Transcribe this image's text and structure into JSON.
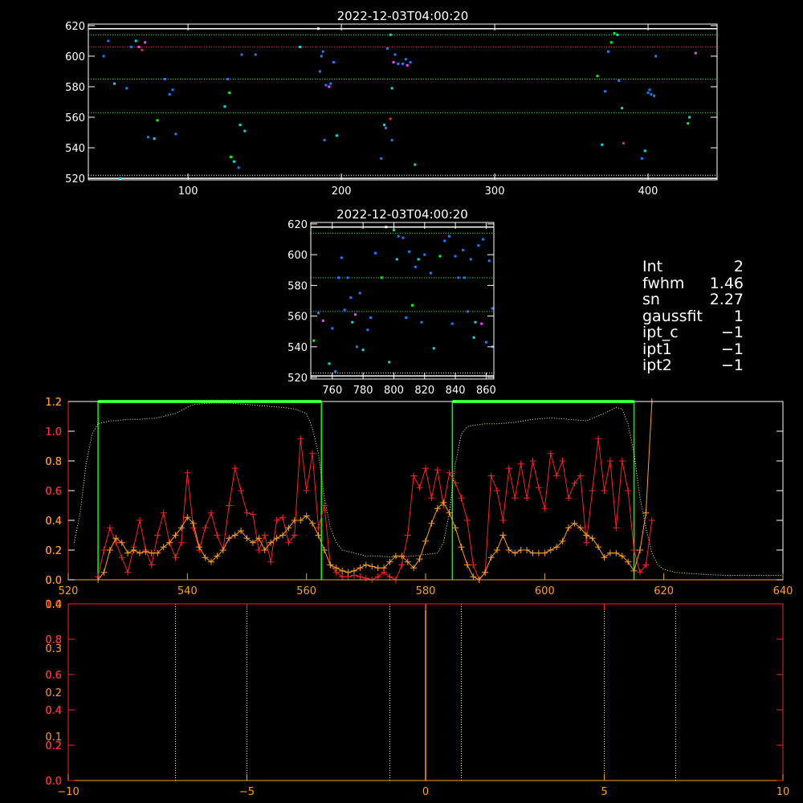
{
  "colors": {
    "background": "#000000",
    "white": "#ffffff",
    "green": "#00ff00",
    "red": "#ff2020",
    "orange": "#ff9f1a",
    "yellow": "#ffff80",
    "blue": "#1e7bff",
    "cyan": "#00e0e0",
    "magenta": "#ff40ff"
  },
  "info": [
    {
      "key": "Int",
      "value": "2"
    },
    {
      "key": "fwhm",
      "value": "1.46"
    },
    {
      "key": "sn",
      "value": "2.27"
    },
    {
      "key": "gaussfit",
      "value": "1"
    },
    {
      "key": "ipt_c",
      "value": "−1"
    },
    {
      "key": "ipt1",
      "value": "−1"
    },
    {
      "key": "ipt2",
      "value": "−1"
    }
  ],
  "chart_data": [
    {
      "type": "scatter",
      "title": "2022-12-03T04:00:20",
      "xlim": [
        35,
        445
      ],
      "ylim": [
        519,
        621
      ],
      "xticks": [
        100,
        200,
        300,
        400
      ],
      "yticks": [
        520,
        540,
        560,
        580,
        600,
        620
      ],
      "hlines": [
        {
          "y": 618,
          "style": "solid",
          "color": "white"
        },
        {
          "y": 614,
          "style": "dotted",
          "color": "green"
        },
        {
          "y": 606,
          "style": "dotted",
          "color": "red"
        },
        {
          "y": 585,
          "style": "dotted",
          "color": "green"
        },
        {
          "y": 563,
          "style": "dotted",
          "color": "green"
        },
        {
          "y": 522,
          "style": "dotted",
          "color": "white"
        },
        {
          "y": 520,
          "style": "solid",
          "color": "white"
        }
      ],
      "points": [
        [
          45,
          600,
          "blue"
        ],
        [
          48,
          610,
          "blue"
        ],
        [
          52,
          582,
          "cyan"
        ],
        [
          56,
          520,
          "cyan"
        ],
        [
          60,
          579,
          "blue"
        ],
        [
          63,
          606,
          "blue"
        ],
        [
          66,
          610,
          "cyan"
        ],
        [
          68,
          606,
          "magenta"
        ],
        [
          70,
          604,
          "red"
        ],
        [
          72,
          609,
          "magenta"
        ],
        [
          74,
          547,
          "blue"
        ],
        [
          78,
          546,
          "cyan"
        ],
        [
          80,
          558,
          "green"
        ],
        [
          85,
          585,
          "blue"
        ],
        [
          88,
          575,
          "blue"
        ],
        [
          90,
          578,
          "blue"
        ],
        [
          92,
          549,
          "blue"
        ],
        [
          124,
          567,
          "cyan"
        ],
        [
          126,
          585,
          "blue"
        ],
        [
          127,
          576,
          "green"
        ],
        [
          128,
          534,
          "green"
        ],
        [
          130,
          531,
          "cyan"
        ],
        [
          133,
          527,
          "blue"
        ],
        [
          134,
          555,
          "cyan"
        ],
        [
          135,
          601,
          "blue"
        ],
        [
          137,
          551,
          "cyan"
        ],
        [
          144,
          601,
          "blue"
        ],
        [
          173,
          606,
          "cyan"
        ],
        [
          185,
          618,
          "white"
        ],
        [
          186,
          590,
          "blue"
        ],
        [
          187,
          600,
          "blue"
        ],
        [
          188,
          603,
          "blue"
        ],
        [
          189,
          545,
          "blue"
        ],
        [
          190,
          581,
          "blue"
        ],
        [
          192,
          580,
          "magenta"
        ],
        [
          193,
          582,
          "blue"
        ],
        [
          195,
          596,
          "blue"
        ],
        [
          197,
          548,
          "cyan"
        ],
        [
          226,
          533,
          "blue"
        ],
        [
          228,
          555,
          "cyan"
        ],
        [
          229,
          553,
          "blue"
        ],
        [
          230,
          605,
          "blue"
        ],
        [
          232,
          559,
          "red"
        ],
        [
          233,
          579,
          "cyan"
        ],
        [
          233,
          545,
          "blue"
        ],
        [
          234,
          596,
          "magenta"
        ],
        [
          235,
          601,
          "blue"
        ],
        [
          237,
          595,
          "blue"
        ],
        [
          240,
          595,
          "blue"
        ],
        [
          242,
          598,
          "blue"
        ],
        [
          243,
          594,
          "magenta"
        ],
        [
          245,
          596,
          "blue"
        ],
        [
          248,
          529,
          "green"
        ],
        [
          232,
          614,
          "cyan"
        ],
        [
          367,
          587,
          "green"
        ],
        [
          370,
          542,
          "cyan"
        ],
        [
          372,
          577,
          "blue"
        ],
        [
          374,
          603,
          "blue"
        ],
        [
          376,
          609,
          "green"
        ],
        [
          378,
          615,
          "green"
        ],
        [
          380,
          614,
          "cyan"
        ],
        [
          381,
          584,
          "blue"
        ],
        [
          383,
          566,
          "cyan"
        ],
        [
          384,
          543,
          "red"
        ],
        [
          396,
          533,
          "blue"
        ],
        [
          398,
          538,
          "cyan"
        ],
        [
          400,
          576,
          "blue"
        ],
        [
          401,
          578,
          "blue"
        ],
        [
          402,
          575,
          "blue"
        ],
        [
          404,
          574,
          "blue"
        ],
        [
          405,
          600,
          "blue"
        ],
        [
          426,
          556,
          "green"
        ],
        [
          427,
          560,
          "cyan"
        ],
        [
          431,
          602,
          "magenta"
        ]
      ]
    },
    {
      "type": "scatter",
      "title": "2022-12-03T04:00:20",
      "xlim": [
        746,
        865
      ],
      "ylim": [
        519,
        621
      ],
      "xticks": [
        760,
        780,
        800,
        820,
        840,
        860
      ],
      "yticks": [
        520,
        540,
        560,
        580,
        600,
        620
      ],
      "hlines": [
        {
          "y": 618,
          "style": "solid",
          "color": "white"
        },
        {
          "y": 614,
          "style": "dotted",
          "color": "green"
        },
        {
          "y": 585,
          "style": "dotted",
          "color": "green"
        },
        {
          "y": 563,
          "style": "dotted",
          "color": "green"
        },
        {
          "y": 523,
          "style": "dotted",
          "color": "white"
        },
        {
          "y": 521,
          "style": "solid",
          "color": "white"
        }
      ],
      "points": [
        [
          748,
          544,
          "green"
        ],
        [
          751,
          562,
          "blue"
        ],
        [
          754,
          557,
          "magenta"
        ],
        [
          758,
          529,
          "cyan"
        ],
        [
          760,
          552,
          "blue"
        ],
        [
          762,
          524,
          "blue"
        ],
        [
          764,
          585,
          "blue"
        ],
        [
          766,
          598,
          "blue"
        ],
        [
          768,
          564,
          "blue"
        ],
        [
          770,
          585,
          "blue"
        ],
        [
          772,
          572,
          "blue"
        ],
        [
          773,
          556,
          "cyan"
        ],
        [
          775,
          561,
          "magenta"
        ],
        [
          776,
          540,
          "blue"
        ],
        [
          778,
          575,
          "blue"
        ],
        [
          780,
          538,
          "cyan"
        ],
        [
          783,
          551,
          "blue"
        ],
        [
          785,
          559,
          "blue"
        ],
        [
          788,
          601,
          "blue"
        ],
        [
          792,
          585,
          "green"
        ],
        [
          795,
          618,
          "white"
        ],
        [
          797,
          530,
          "cyan"
        ],
        [
          800,
          616,
          "green"
        ],
        [
          802,
          597,
          "cyan"
        ],
        [
          803,
          612,
          "blue"
        ],
        [
          806,
          611,
          "blue"
        ],
        [
          808,
          559,
          "blue"
        ],
        [
          810,
          602,
          "blue"
        ],
        [
          812,
          567,
          "green"
        ],
        [
          814,
          592,
          "blue"
        ],
        [
          816,
          597,
          "cyan"
        ],
        [
          818,
          556,
          "blue"
        ],
        [
          820,
          600,
          "blue"
        ],
        [
          824,
          588,
          "blue"
        ],
        [
          826,
          539,
          "cyan"
        ],
        [
          830,
          599,
          "green"
        ],
        [
          833,
          609,
          "blue"
        ],
        [
          836,
          612,
          "blue"
        ],
        [
          838,
          555,
          "blue"
        ],
        [
          840,
          599,
          "blue"
        ],
        [
          842,
          585,
          "blue"
        ],
        [
          845,
          603,
          "blue"
        ],
        [
          846,
          585,
          "blue"
        ],
        [
          848,
          563,
          "blue"
        ],
        [
          850,
          597,
          "blue"
        ],
        [
          852,
          546,
          "cyan"
        ],
        [
          853,
          556,
          "cyan"
        ],
        [
          855,
          606,
          "blue"
        ],
        [
          857,
          555,
          "magenta"
        ],
        [
          858,
          610,
          "blue"
        ],
        [
          860,
          543,
          "blue"
        ],
        [
          862,
          596,
          "blue"
        ],
        [
          864,
          565,
          "blue"
        ],
        [
          864,
          540,
          "blue"
        ]
      ]
    },
    {
      "type": "line",
      "xlim": [
        520,
        640
      ],
      "ylim": [
        0,
        1.2
      ],
      "xticks": [
        520,
        540,
        560,
        580,
        600,
        620,
        640
      ],
      "yticks": [
        0.0,
        0.2,
        0.4,
        0.6,
        0.8,
        1.0,
        1.2
      ],
      "yticks_red": [
        0.0,
        0.2,
        0.4,
        0.6,
        0.8,
        1.0,
        1.2
      ],
      "yticks_orange": [
        0.0,
        0.2,
        0.4,
        0.8,
        1.2
      ],
      "green_boxes": [
        [
          525,
          562.5
        ],
        [
          584.5,
          615
        ]
      ],
      "transmission_x": [
        521,
        522,
        523,
        524,
        525,
        526,
        527,
        528,
        530,
        532,
        535,
        538,
        541,
        544,
        547,
        550,
        553,
        556,
        558,
        560,
        561,
        562,
        563,
        564,
        565,
        566,
        568,
        570,
        572,
        575,
        578,
        580,
        582,
        583,
        584,
        585,
        586,
        587,
        588,
        590,
        592,
        595,
        598,
        601,
        604,
        607,
        610,
        612,
        613,
        614,
        615,
        616,
        617,
        618,
        619,
        620,
        622,
        625,
        630,
        635,
        640
      ],
      "transmission_y": [
        0.25,
        0.45,
        0.78,
        0.98,
        1.05,
        1.06,
        1.07,
        1.07,
        1.08,
        1.08,
        1.09,
        1.12,
        1.18,
        1.19,
        1.19,
        1.18,
        1.17,
        1.16,
        1.15,
        1.12,
        1.02,
        0.85,
        0.55,
        0.35,
        0.25,
        0.2,
        0.18,
        0.16,
        0.16,
        0.15,
        0.16,
        0.17,
        0.18,
        0.25,
        0.45,
        0.78,
        0.98,
        1.03,
        1.04,
        1.05,
        1.05,
        1.06,
        1.08,
        1.09,
        1.08,
        1.07,
        1.12,
        1.16,
        1.15,
        1.05,
        0.85,
        0.55,
        0.35,
        0.18,
        0.1,
        0.07,
        0.05,
        0.04,
        0.03,
        0.03,
        0.03
      ],
      "red_x": [
        525,
        526,
        527,
        528,
        529,
        530,
        531,
        532,
        533,
        534,
        535,
        536,
        537,
        538,
        539,
        540,
        541,
        542,
        543,
        544,
        545,
        546,
        547,
        548,
        549,
        550,
        551,
        552,
        553,
        554,
        555,
        556,
        557,
        558,
        559,
        560,
        561,
        562,
        563,
        564,
        565,
        566,
        567,
        568,
        569,
        570,
        571,
        572,
        573,
        574,
        575,
        576,
        577,
        578,
        579,
        580,
        581,
        582,
        583,
        584,
        585,
        586,
        587,
        588,
        589,
        590,
        591,
        592,
        593,
        594,
        595,
        596,
        597,
        598,
        599,
        600,
        601,
        602,
        603,
        604,
        605,
        606,
        607,
        608,
        609,
        610,
        611,
        612,
        613,
        614,
        615,
        616,
        617,
        618
      ],
      "red_y": [
        0.02,
        0.2,
        0.35,
        0.25,
        0.15,
        0.05,
        0.22,
        0.4,
        0.2,
        0.1,
        0.3,
        0.45,
        0.25,
        0.15,
        0.25,
        0.72,
        0.35,
        0.2,
        0.35,
        0.45,
        0.3,
        0.2,
        0.5,
        0.75,
        0.6,
        0.45,
        0.44,
        0.2,
        0.3,
        0.12,
        0.4,
        0.42,
        0.25,
        0.3,
        0.95,
        0.6,
        0.85,
        0.35,
        0.5,
        0.1,
        0.05,
        0.02,
        0.02,
        0.03,
        0.02,
        0.01,
        0.0,
        0.02,
        0.05,
        0.02,
        0.0,
        0.1,
        0.3,
        0.7,
        0.62,
        0.75,
        0.55,
        0.74,
        0.5,
        0.72,
        0.65,
        0.55,
        0.4,
        0.1,
        0.0,
        0.05,
        0.7,
        0.6,
        0.4,
        0.75,
        0.55,
        0.78,
        0.55,
        0.8,
        0.62,
        0.48,
        0.85,
        0.7,
        0.8,
        0.55,
        0.65,
        0.7,
        0.25,
        0.6,
        0.95,
        0.6,
        0.8,
        0.35,
        0.8,
        0.6,
        0.2,
        0.05,
        0.1,
        0.4
      ],
      "orange_x": [
        525,
        526,
        527,
        528,
        529,
        530,
        531,
        532,
        533,
        534,
        535,
        536,
        537,
        538,
        539,
        540,
        541,
        542,
        543,
        544,
        545,
        546,
        547,
        548,
        549,
        550,
        551,
        552,
        553,
        554,
        555,
        556,
        557,
        558,
        559,
        560,
        561,
        562,
        563,
        564,
        565,
        566,
        567,
        568,
        569,
        570,
        571,
        572,
        573,
        574,
        575,
        576,
        577,
        578,
        579,
        580,
        581,
        582,
        583,
        584,
        585,
        586,
        587,
        588,
        589,
        590,
        591,
        592,
        593,
        594,
        595,
        596,
        597,
        598,
        599,
        600,
        601,
        602,
        603,
        604,
        605,
        606,
        607,
        608,
        609,
        610,
        611,
        612,
        613,
        614,
        615,
        616,
        617,
        618
      ],
      "orange_y": [
        0.0,
        0.05,
        0.2,
        0.28,
        0.25,
        0.18,
        0.2,
        0.18,
        0.19,
        0.18,
        0.18,
        0.22,
        0.25,
        0.3,
        0.35,
        0.42,
        0.38,
        0.22,
        0.15,
        0.12,
        0.16,
        0.2,
        0.28,
        0.3,
        0.33,
        0.28,
        0.25,
        0.28,
        0.2,
        0.25,
        0.28,
        0.3,
        0.35,
        0.4,
        0.4,
        0.43,
        0.38,
        0.3,
        0.2,
        0.1,
        0.08,
        0.06,
        0.05,
        0.06,
        0.08,
        0.1,
        0.09,
        0.08,
        0.08,
        0.12,
        0.16,
        0.16,
        0.12,
        0.08,
        0.14,
        0.26,
        0.38,
        0.48,
        0.52,
        0.45,
        0.35,
        0.22,
        0.1,
        0.02,
        0.0,
        0.05,
        0.15,
        0.2,
        0.3,
        0.2,
        0.18,
        0.2,
        0.2,
        0.18,
        0.18,
        0.18,
        0.2,
        0.22,
        0.26,
        0.35,
        0.38,
        0.35,
        0.3,
        0.28,
        0.22,
        0.15,
        0.18,
        0.18,
        0.16,
        0.12,
        0.06,
        0.2,
        0.45,
        1.2
      ]
    },
    {
      "type": "line",
      "xlim": [
        -10,
        10
      ],
      "ylim": [
        0,
        1.0
      ],
      "xticks": [
        -10,
        -5,
        0,
        5,
        10
      ],
      "yticks": [
        0.0,
        0.2,
        0.4,
        0.6,
        0.8,
        1.0
      ],
      "yticks_red": [
        0.0,
        0.2,
        0.4,
        0.6,
        0.8,
        1.0
      ],
      "yticks_orange": [
        0.1,
        0.2,
        0.3,
        0.4
      ],
      "dotted_x_yellow": [
        -7,
        -5,
        -1,
        1,
        5,
        7
      ],
      "orange_line_x": 0
    }
  ]
}
